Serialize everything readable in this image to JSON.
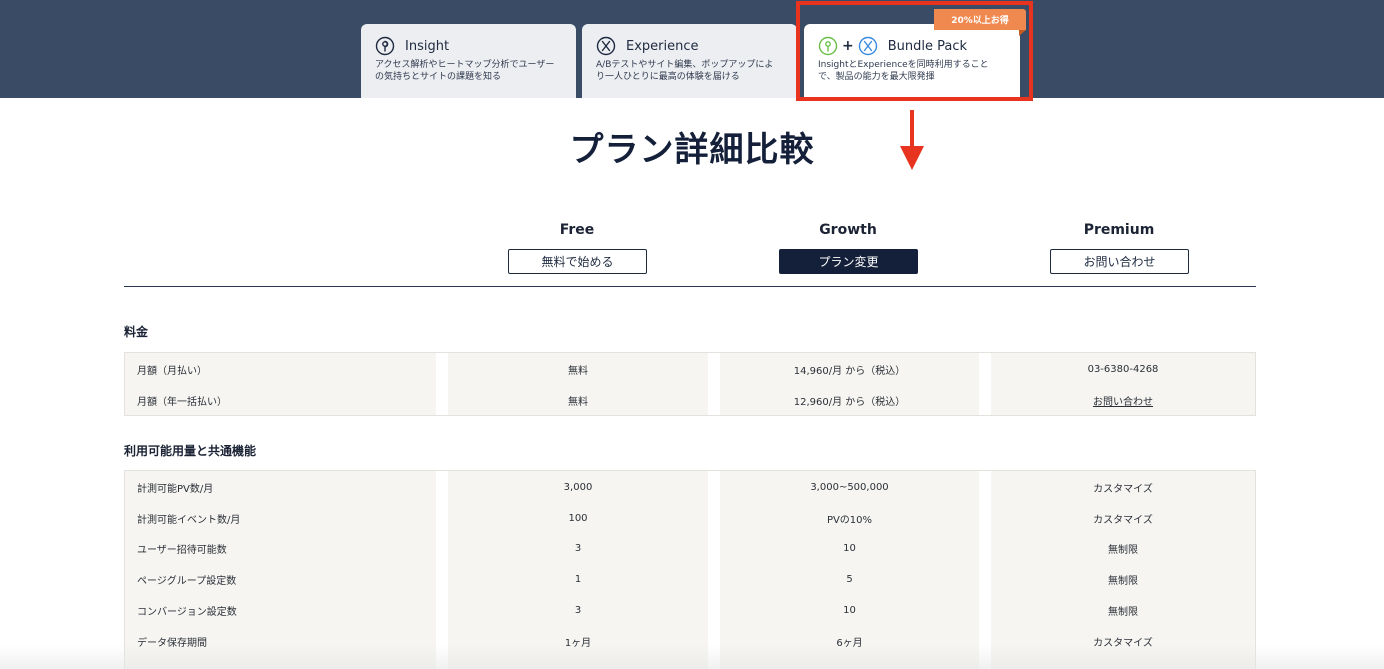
{
  "tabs": [
    {
      "title": "Insight",
      "desc": "アクセス解析やヒートマップ分析でユーザー\nの気持ちとサイトの課題を知る",
      "icon": "insight-icon"
    },
    {
      "title": "Experience",
      "desc": "A/Bテストやサイト編集、ポップアップによ\nり一人ひとりに最高の体験を届ける",
      "icon": "experience-icon"
    },
    {
      "title": "Bundle Pack",
      "plus": "+",
      "desc": "InsightとExperienceを同時利用すること\nで、製品の能力を最大限発揮",
      "badge": "20%以上お得",
      "icon": "bundle-icon"
    }
  ],
  "page_title": "プラン詳細比較",
  "plans": [
    {
      "name": "Free",
      "button": "無料で始める"
    },
    {
      "name": "Growth",
      "button": "プラン変更"
    },
    {
      "name": "Premium",
      "button": "お問い合わせ"
    }
  ],
  "sections": [
    {
      "title": "料金",
      "rows": [
        {
          "label": "月額（月払い）",
          "free": "無料",
          "growth": "14,960/月 から（税込）",
          "premium": "03-6380-4268"
        },
        {
          "label": "月額（年一括払い）",
          "free": "無料",
          "growth": "12,960/月 から（税込）",
          "premium": "お問い合わせ"
        }
      ]
    },
    {
      "title": "利用可能用量と共通機能",
      "rows": [
        {
          "label": "計測可能PV数/月",
          "free": "3,000",
          "growth": "3,000~500,000",
          "premium": "カスタマイズ"
        },
        {
          "label": "計測可能イベント数/月",
          "free": "100",
          "growth": "PVの10%",
          "premium": "カスタマイズ"
        },
        {
          "label": "ユーザー招待可能数",
          "free": "3",
          "growth": "10",
          "premium": "無制限"
        },
        {
          "label": "ページグループ設定数",
          "free": "1",
          "growth": "5",
          "premium": "無制限"
        },
        {
          "label": "コンバージョン設定数",
          "free": "3",
          "growth": "10",
          "premium": "無制限"
        },
        {
          "label": "データ保存期間",
          "free": "1ヶ月",
          "growth": "6ヶ月",
          "premium": "カスタマイズ"
        }
      ]
    }
  ],
  "colors": {
    "header_bg": "#3a4b66",
    "accent_red": "#e8331f",
    "badge_orange": "#f0894f",
    "navy": "#14203a"
  }
}
